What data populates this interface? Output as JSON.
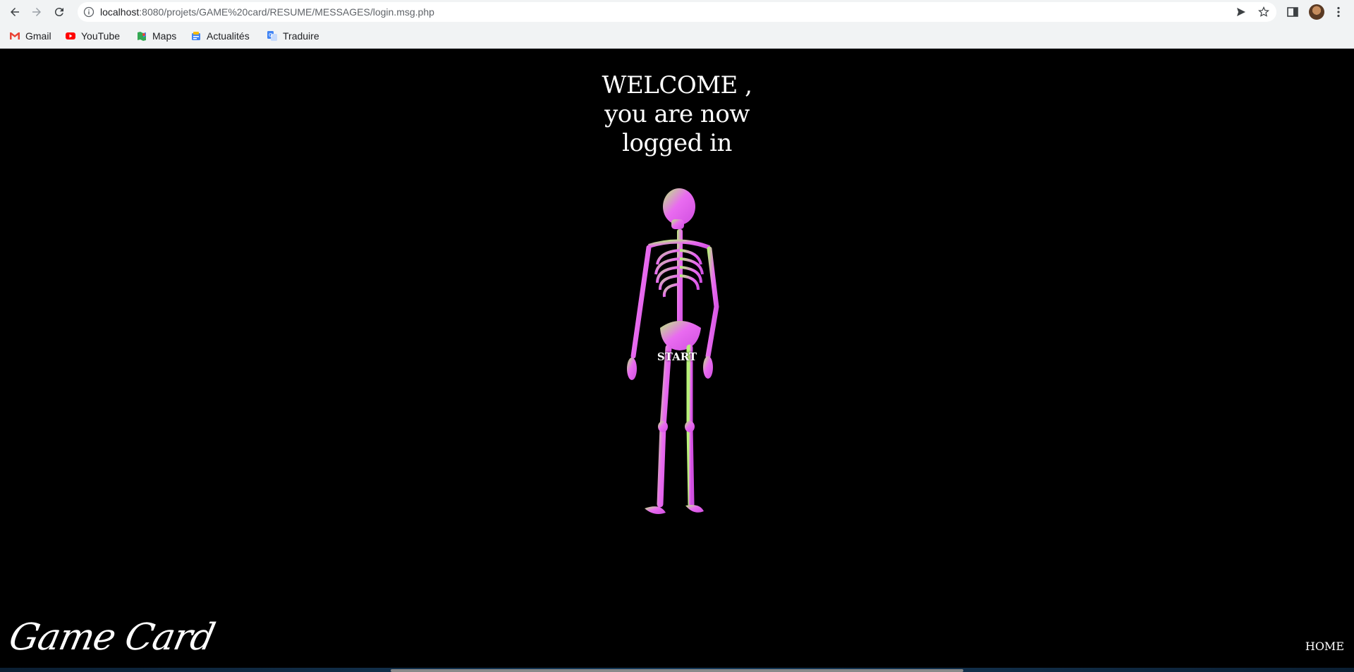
{
  "browser": {
    "url_host": "localhost",
    "url_path": ":8080/projets/GAME%20card/RESUME/MESSAGES/login.msg.php"
  },
  "bookmarks": [
    {
      "label": "Gmail",
      "icon": "gmail-icon"
    },
    {
      "label": "YouTube",
      "icon": "youtube-icon"
    },
    {
      "label": "Maps",
      "icon": "maps-icon"
    },
    {
      "label": "Actualités",
      "icon": "news-icon"
    },
    {
      "label": "Traduire",
      "icon": "translate-icon"
    }
  ],
  "page": {
    "welcome_line1": "WELCOME ,",
    "welcome_line2": "you are now",
    "welcome_line3": "logged in",
    "start_label": "START",
    "brand": "Game Card",
    "home_label": "HOME"
  },
  "colors": {
    "background": "#000000",
    "text": "#ffffff",
    "skeleton_primary": "#e96bf0",
    "skeleton_secondary": "#b8f27a"
  }
}
